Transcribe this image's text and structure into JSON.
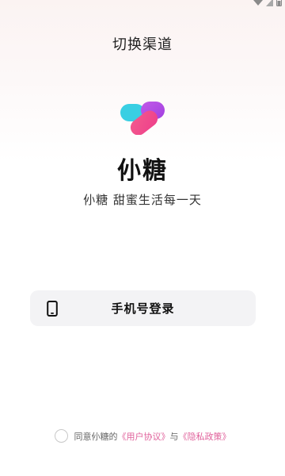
{
  "header": {
    "title": "切换渠道"
  },
  "app": {
    "name": "仦糖",
    "tagline": "仦糖 甜蜜生活每一天"
  },
  "login": {
    "phone_login_label": "手机号登录"
  },
  "agreement": {
    "prefix": "同意仦糖的",
    "user_agreement": "《用户协议》",
    "connector": "与",
    "privacy_policy": "《隐私政策》"
  },
  "status_bar": {
    "icons": [
      "wifi-icon",
      "signal-icon",
      "battery-icon"
    ]
  },
  "colors": {
    "brand_pink": "#f24f8e",
    "brand_cyan": "#39cfe3",
    "brand_purple": "#b147e6",
    "link": "#e0619b",
    "button_bg": "#f3f3f5"
  }
}
